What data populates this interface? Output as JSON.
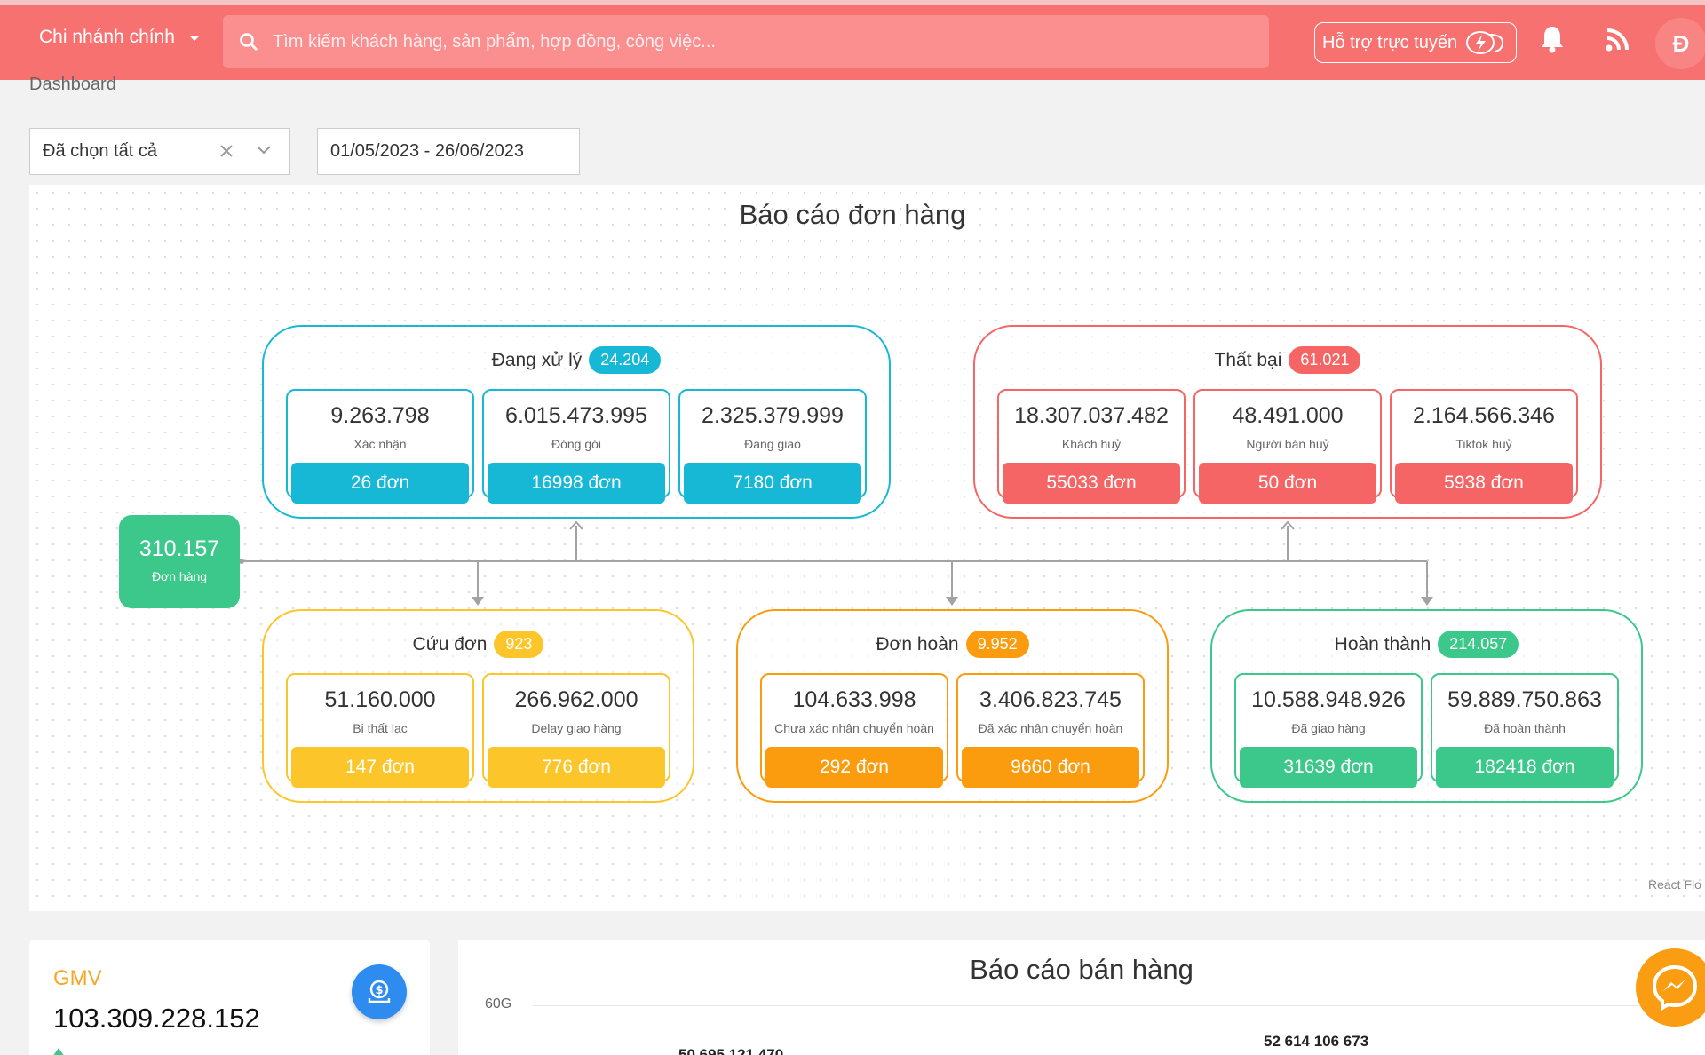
{
  "header": {
    "branch": "Chi nhánh chính",
    "search_placeholder": "Tìm kiếm khách hàng, sản phẩm, hợp đồng, công việc...",
    "support": "Hỗ trợ trực tuyến",
    "avatar": "Đ"
  },
  "page_title": "Dashboard",
  "filters": {
    "selection": "Đã chọn tất cả",
    "date_range": "01/05/2023 - 26/06/2023"
  },
  "order_report": {
    "title": "Báo cáo đơn hàng",
    "root": {
      "value": "310.157",
      "label": "Đơn hàng"
    },
    "groups": {
      "processing": {
        "title": "Đang xử lý",
        "count": "24.204",
        "cards": [
          {
            "value": "9.263.798",
            "label": "Xác nhận",
            "orders": "26 đơn"
          },
          {
            "value": "6.015.473.995",
            "label": "Đóng gói",
            "orders": "16998 đơn"
          },
          {
            "value": "2.325.379.999",
            "label": "Đang giao",
            "orders": "7180 đơn"
          }
        ]
      },
      "failed": {
        "title": "Thất bại",
        "count": "61.021",
        "cards": [
          {
            "value": "18.307.037.482",
            "label": "Khách huỷ",
            "orders": "55033 đơn"
          },
          {
            "value": "48.491.000",
            "label": "Người bán huỷ",
            "orders": "50 đơn"
          },
          {
            "value": "2.164.566.346",
            "label": "Tiktok huỷ",
            "orders": "5938 đơn"
          }
        ]
      },
      "rescue": {
        "title": "Cứu đơn",
        "count": "923",
        "cards": [
          {
            "value": "51.160.000",
            "label": "Bị thất lạc",
            "orders": "147 đơn"
          },
          {
            "value": "266.962.000",
            "label": "Delay giao hàng",
            "orders": "776 đơn"
          }
        ]
      },
      "returned": {
        "title": "Đơn hoàn",
        "count": "9.952",
        "cards": [
          {
            "value": "104.633.998",
            "label": "Chưa xác nhận chuyển hoàn",
            "orders": "292 đơn"
          },
          {
            "value": "3.406.823.745",
            "label": "Đã xác nhận chuyển hoàn",
            "orders": "9660 đơn"
          }
        ]
      },
      "completed": {
        "title": "Hoàn thành",
        "count": "214.057",
        "cards": [
          {
            "value": "10.588.948.926",
            "label": "Đã giao hàng",
            "orders": "31639 đơn"
          },
          {
            "value": "59.889.750.863",
            "label": "Đã hoàn thành",
            "orders": "182418 đơn"
          }
        ]
      }
    },
    "attribution": "React Flo"
  },
  "gmv": {
    "title": "GMV",
    "value": "103.309.228.152"
  },
  "sales_report": {
    "title": "Báo cáo bán hàng",
    "axis_top": "60G",
    "bar_label_1": "50 695 121 470",
    "bar_label_2": "52 614 106 673"
  },
  "colors": {
    "header": "#f87171",
    "processing": "#17b8d6",
    "failed": "#f56565",
    "rescue": "#fcc62b",
    "returned": "#fb9c0f",
    "completed": "#3cc88a"
  }
}
